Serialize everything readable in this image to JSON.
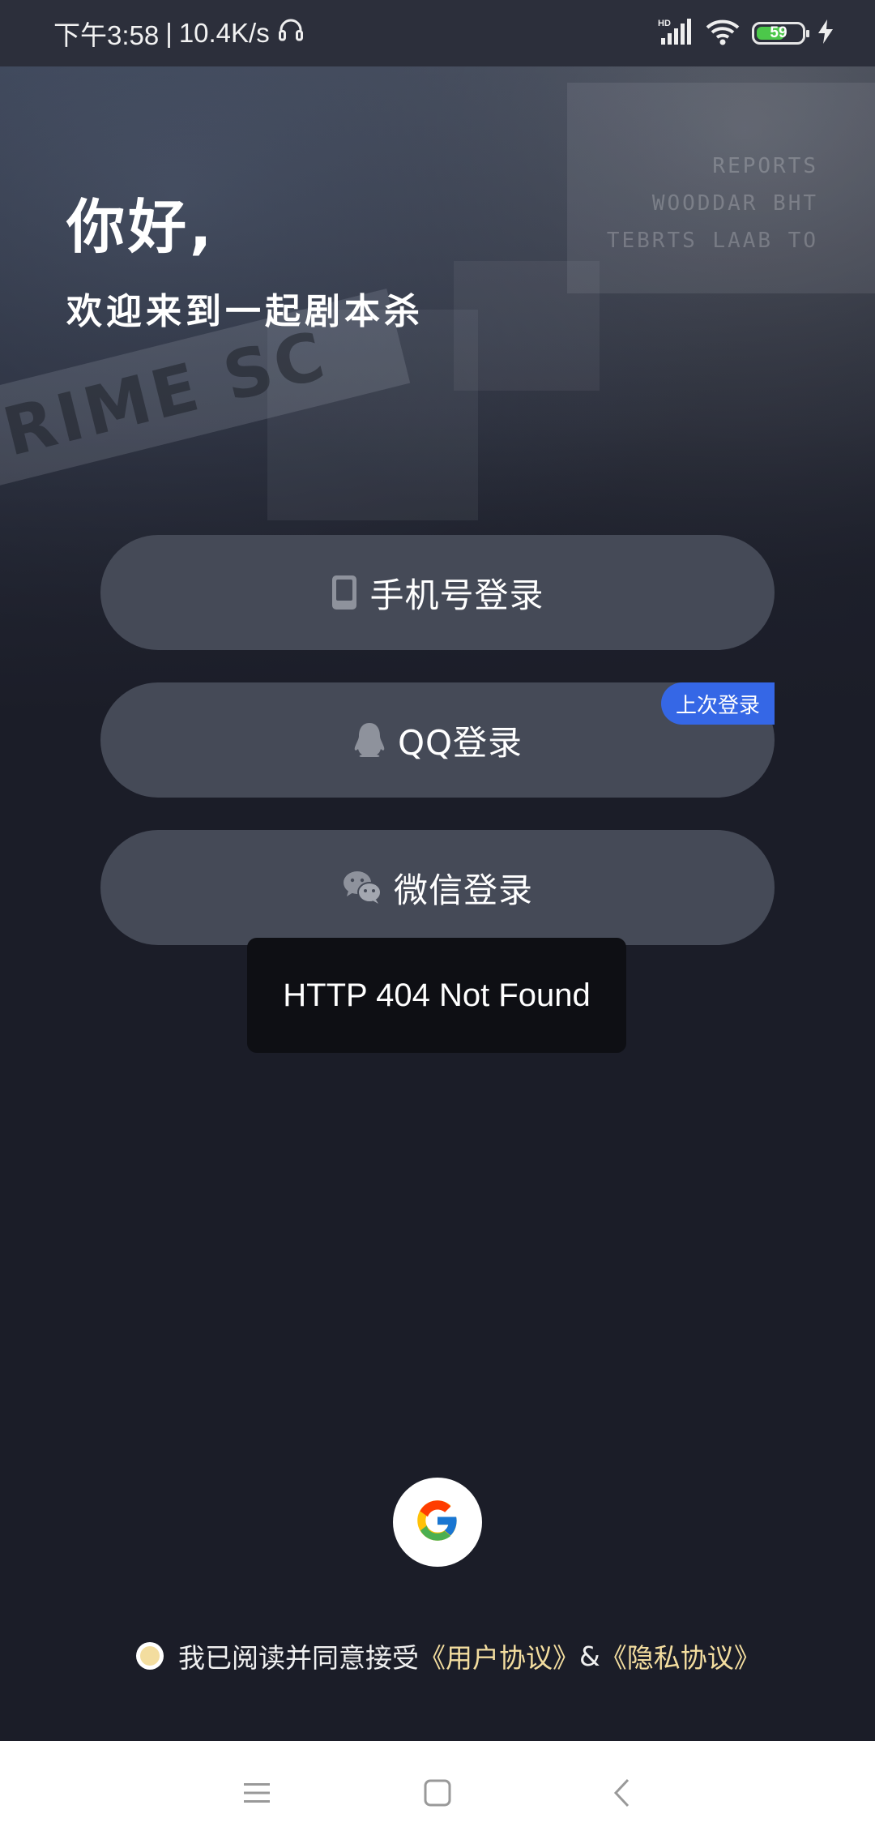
{
  "status_bar": {
    "time": "下午3:58",
    "separator": "|",
    "net_speed": "10.4K/s",
    "battery_level": "59",
    "icons": [
      "headphones-icon",
      "signal-hd-icon",
      "wifi-icon",
      "battery-icon",
      "charging-icon"
    ]
  },
  "hero": {
    "greeting": "你好,",
    "welcome": "欢迎来到一起剧本杀",
    "tape_text": "RIME SC",
    "paper_lines": [
      "REPORTS",
      "WOODDAR BHT",
      "TEBRTS LAAB TO"
    ]
  },
  "login": {
    "phone_label": "手机号登录",
    "qq_label": "QQ登录",
    "qq_badge": "上次登录",
    "wechat_label": "微信登录"
  },
  "toast": {
    "message": "HTTP 404 Not Found"
  },
  "agreement": {
    "prefix": "我已阅读并同意接受",
    "user_agreement": "《用户协议》",
    "amp": "&",
    "privacy_agreement": "《隐私协议》"
  },
  "colors": {
    "background": "#1b1d28",
    "button": "#454a57",
    "badge": "#3567e6",
    "link": "#f3dd9f"
  }
}
